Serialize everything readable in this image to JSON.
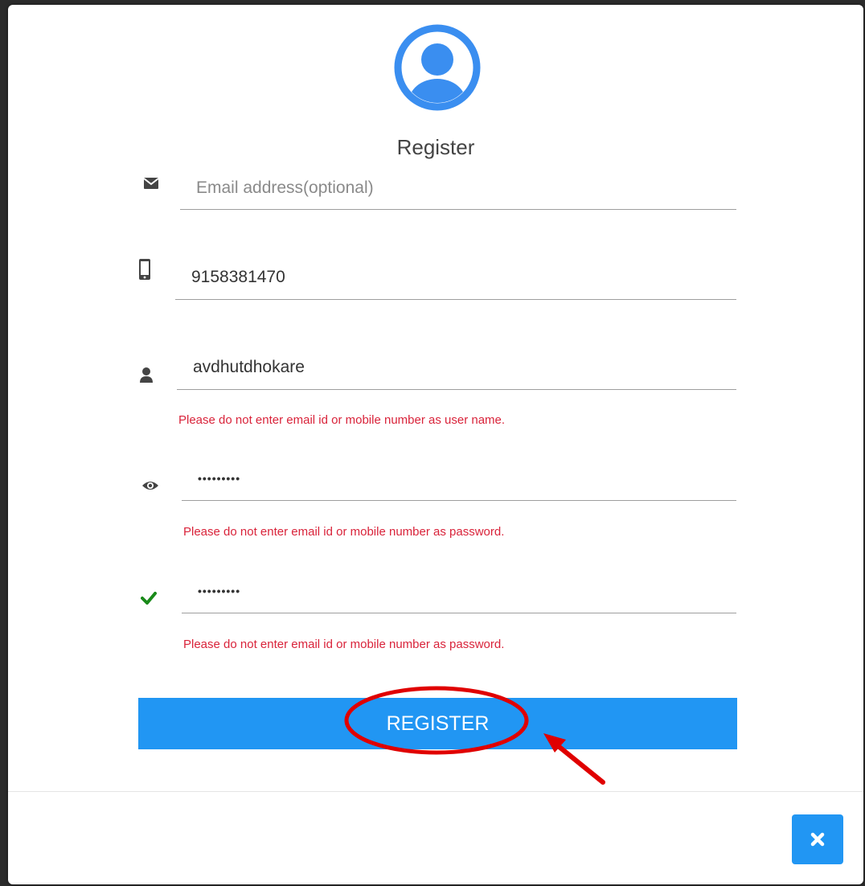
{
  "dialog": {
    "title": "Register"
  },
  "form": {
    "email": {
      "placeholder": "Email address(optional)",
      "value": "",
      "icon": "envelope-icon"
    },
    "mobile": {
      "value": "9158381470",
      "icon": "mobile-phone-icon"
    },
    "username": {
      "value": "avdhutdhokare",
      "icon": "user-icon",
      "error": "Please do not enter email id or mobile number as user name."
    },
    "password": {
      "value": "•••••••••",
      "icon": "eye-icon",
      "error": "Please do not enter email id or mobile number as password."
    },
    "confirm_password": {
      "value": "•••••••••",
      "icon": "check-icon",
      "error": "Please do not enter email id or mobile number as password."
    }
  },
  "actions": {
    "register_label": "REGISTER",
    "close_icon": "close-icon"
  },
  "colors": {
    "accent": "#2196f3",
    "error": "#d9233a",
    "success": "#1a8a1a",
    "annotation": "#e00000"
  }
}
